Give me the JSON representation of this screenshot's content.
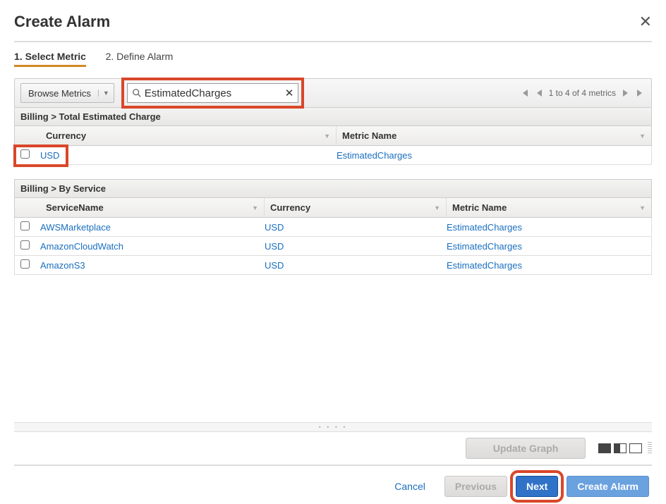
{
  "header": {
    "title": "Create Alarm"
  },
  "steps": {
    "step1": "1. Select Metric",
    "step2": "2. Define Alarm"
  },
  "toolbar": {
    "browse_label": "Browse Metrics",
    "search_value": "EstimatedCharges",
    "pager_text": "1 to 4 of 4 metrics"
  },
  "section1": {
    "title": "Billing > Total Estimated Charge",
    "headers": {
      "currency": "Currency",
      "metric": "Metric Name"
    },
    "rows": [
      {
        "currency": "USD",
        "metric": "EstimatedCharges"
      }
    ]
  },
  "section2": {
    "title": "Billing > By Service",
    "headers": {
      "service": "ServiceName",
      "currency": "Currency",
      "metric": "Metric Name"
    },
    "rows": [
      {
        "service": "AWSMarketplace",
        "currency": "USD",
        "metric": "EstimatedCharges"
      },
      {
        "service": "AmazonCloudWatch",
        "currency": "USD",
        "metric": "EstimatedCharges"
      },
      {
        "service": "AmazonS3",
        "currency": "USD",
        "metric": "EstimatedCharges"
      }
    ]
  },
  "buttons": {
    "update_graph": "Update Graph",
    "cancel": "Cancel",
    "previous": "Previous",
    "next": "Next",
    "create_alarm": "Create Alarm"
  }
}
